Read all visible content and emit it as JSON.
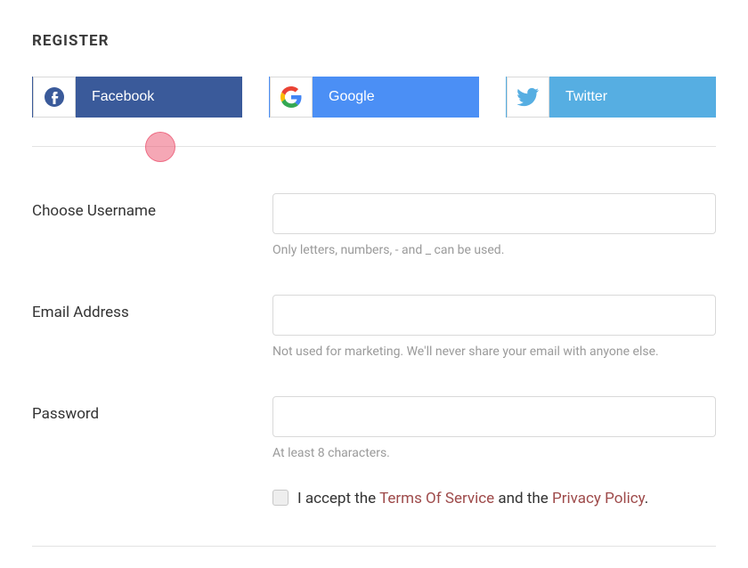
{
  "title": "Register",
  "social": {
    "facebook": "Facebook",
    "google": "Google",
    "twitter": "Twitter"
  },
  "form": {
    "username": {
      "label": "Choose Username",
      "hint": "Only letters, numbers, - and _ can be used.",
      "value": ""
    },
    "email": {
      "label": "Email Address",
      "hint": "Not used for marketing. We'll never share your email with anyone else.",
      "value": ""
    },
    "password": {
      "label": "Password",
      "hint": "At least 8 characters.",
      "value": ""
    }
  },
  "consent": {
    "pre": "I accept the ",
    "tos": "Terms Of Service",
    "mid": " and the ",
    "privacy": "Privacy Policy",
    "post": "."
  }
}
